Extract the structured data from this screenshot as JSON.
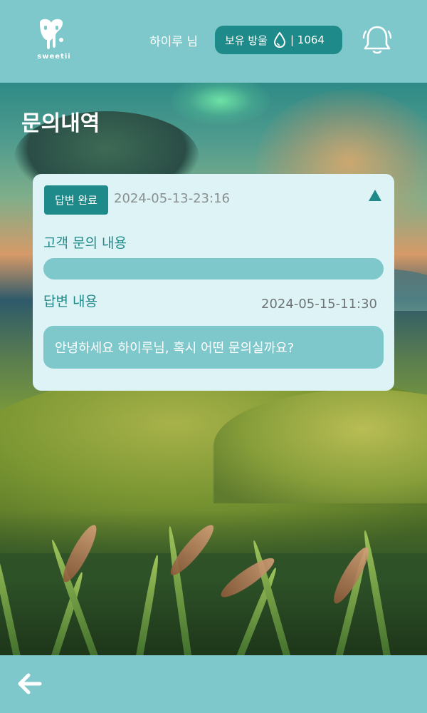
{
  "header": {
    "logo_text": "sweetii",
    "username": "하이루 님",
    "drops_label": "보유 방울",
    "drops_value": "| 1064",
    "logo_icon": "drip-heart-logo",
    "drop_icon": "water-drop-icon",
    "bell_icon": "bell-icon"
  },
  "page": {
    "title": "문의내역"
  },
  "inquiry": {
    "status": "답변 완료",
    "date": "2024-05-13-23:16",
    "collapse_icon": "triangle-up-icon",
    "question_label": "고객 문의 내용",
    "question_text": "",
    "answer_label": "답변 내용",
    "answer_date": "2024-05-15-11:30",
    "answer_text": "안녕하세요 하이루님, 혹시 어떤 문의실까요?"
  },
  "footer": {
    "back_icon": "arrow-left-icon"
  },
  "colors": {
    "primary": "#7ec8cc",
    "accent": "#1f8a8a",
    "card_bg": "#ddf3f5",
    "muted_text": "#8a8f8f"
  }
}
